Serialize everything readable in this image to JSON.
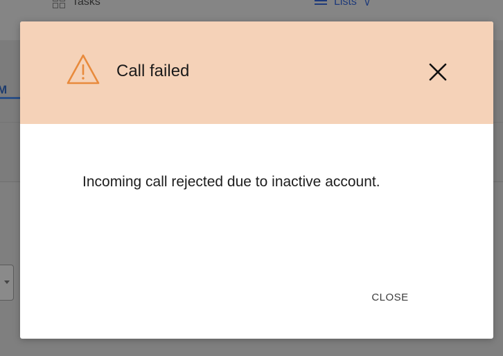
{
  "app": {
    "nav": {
      "tasks_label": "Tasks",
      "lists_label": "Lists",
      "lists_chevron": "∨"
    },
    "tab_fragment": "I M"
  },
  "dialog": {
    "title": "Call failed",
    "message": "Incoming call rejected due to inactive account.",
    "close_label": "CLOSE",
    "icons": {
      "warning": "warning-triangle-icon",
      "close": "close-icon"
    },
    "colors": {
      "header_bg": "#f5d2b8",
      "warning_orange": "#e88a3c",
      "overlay": "#7f7f7f"
    }
  }
}
